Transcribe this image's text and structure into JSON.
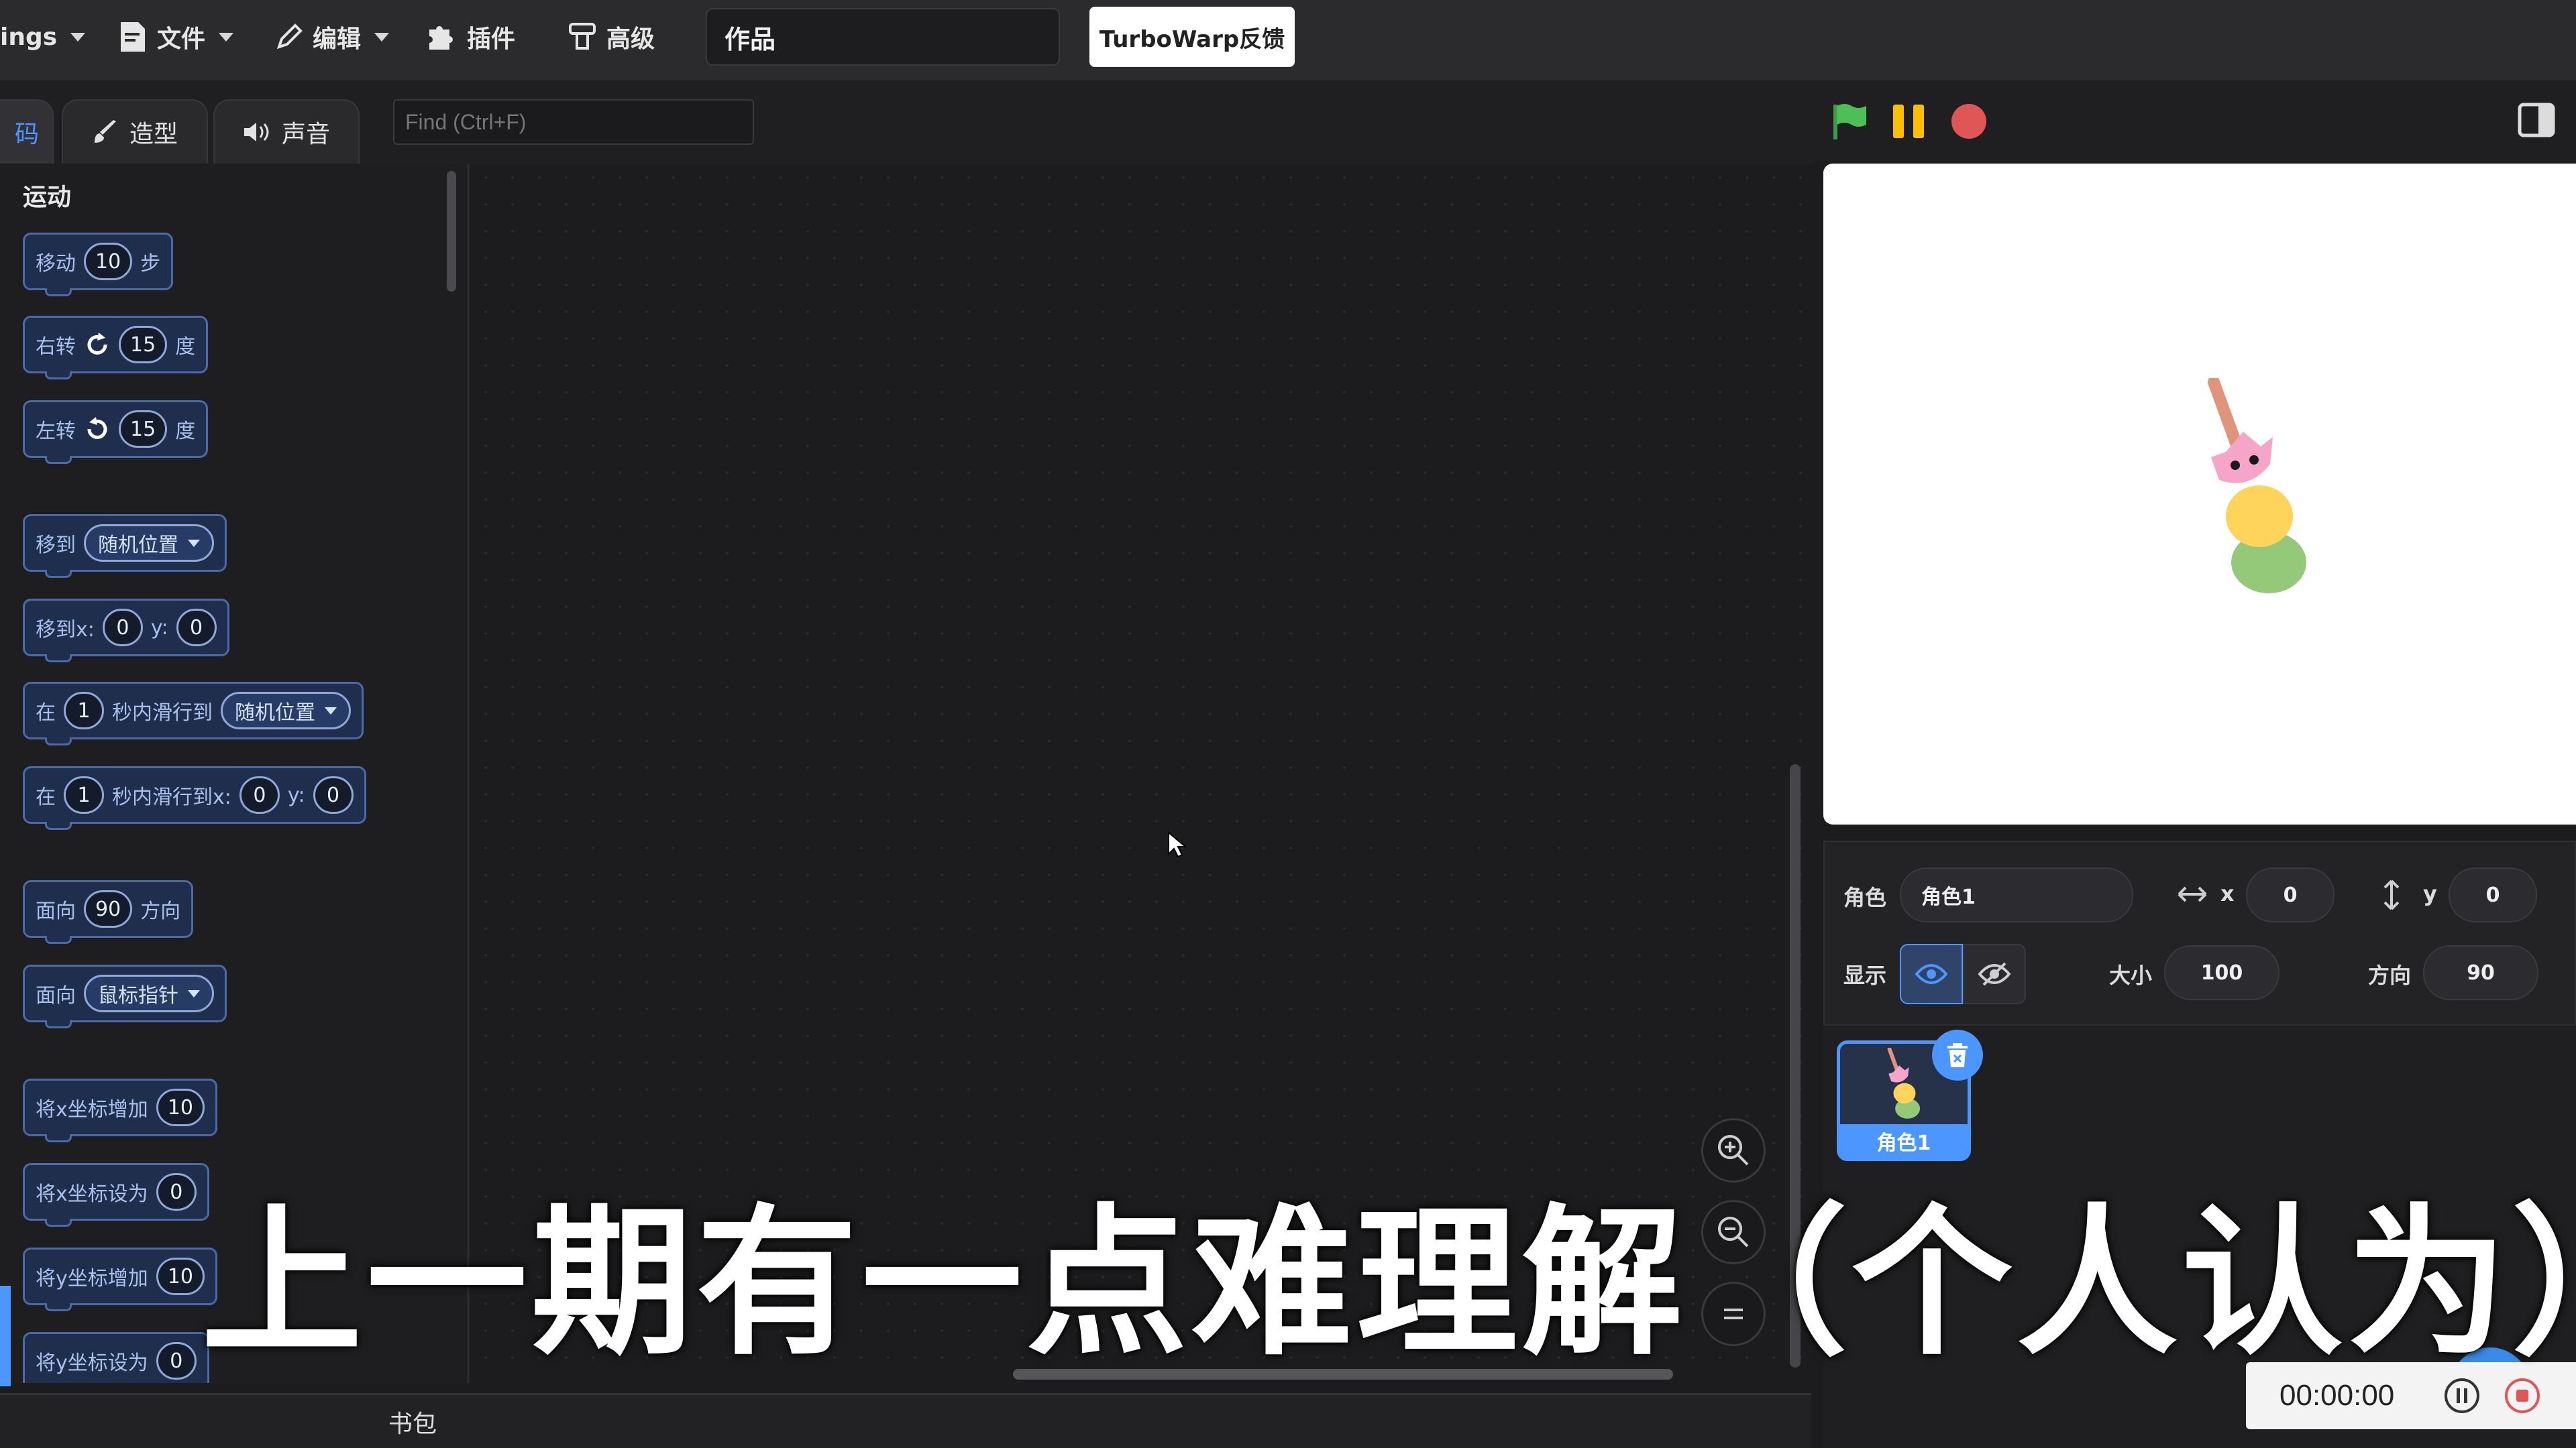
{
  "menu": {
    "settings_label": "ings",
    "file_label": "文件",
    "edit_label": "编辑",
    "addons_label": "插件",
    "advanced_label": "高级",
    "project_title": "作品",
    "feedback_label": "TurboWarp反馈"
  },
  "tabs": {
    "code_label": "码",
    "costumes_label": "造型",
    "sounds_label": "声音",
    "find_placeholder": "Find (Ctrl+F)"
  },
  "palette": {
    "category": "运动",
    "blocks": [
      {
        "parts": [
          "移动",
          "10",
          "步"
        ]
      },
      {
        "parts": [
          "右转",
          "15",
          "度"
        ]
      },
      {
        "parts": [
          "左转",
          "15",
          "度"
        ]
      },
      {
        "parts": [
          "移到",
          "随机位置"
        ]
      },
      {
        "parts": [
          "移到x:",
          "0",
          "y:",
          "0"
        ]
      },
      {
        "parts": [
          "在",
          "1",
          "秒内滑行到",
          "随机位置"
        ]
      },
      {
        "parts": [
          "在",
          "1",
          "秒内滑行到x:",
          "0",
          "y:",
          "0"
        ]
      },
      {
        "parts": [
          "面向",
          "90",
          "方向"
        ]
      },
      {
        "parts": [
          "面向",
          "鼠标指针"
        ]
      },
      {
        "parts": [
          "将x坐标增加",
          "10"
        ]
      },
      {
        "parts": [
          "将x坐标设为",
          "0"
        ]
      },
      {
        "parts": [
          "将y坐标增加",
          "10"
        ]
      },
      {
        "parts": [
          "将y坐标设为",
          "0"
        ]
      }
    ]
  },
  "backpack_label": "书包",
  "sprite_info": {
    "sprite_label": "角色",
    "sprite_name": "角色1",
    "x_label": "x",
    "x_value": "0",
    "y_label": "y",
    "y_value": "0",
    "show_label": "显示",
    "size_label": "大小",
    "size_value": "100",
    "direction_label": "方向",
    "direction_value": "90"
  },
  "sprites": [
    {
      "name": "角色1"
    }
  ],
  "recorder": {
    "time": "00:00:00"
  },
  "caption": "上一期有一点难理解（个人认为）",
  "colors": {
    "accent": "#4c97ff",
    "motion_block": "#1f2e4c",
    "flag": "#4cbf56",
    "pause": "#ffbf00",
    "stop": "#e05555"
  }
}
